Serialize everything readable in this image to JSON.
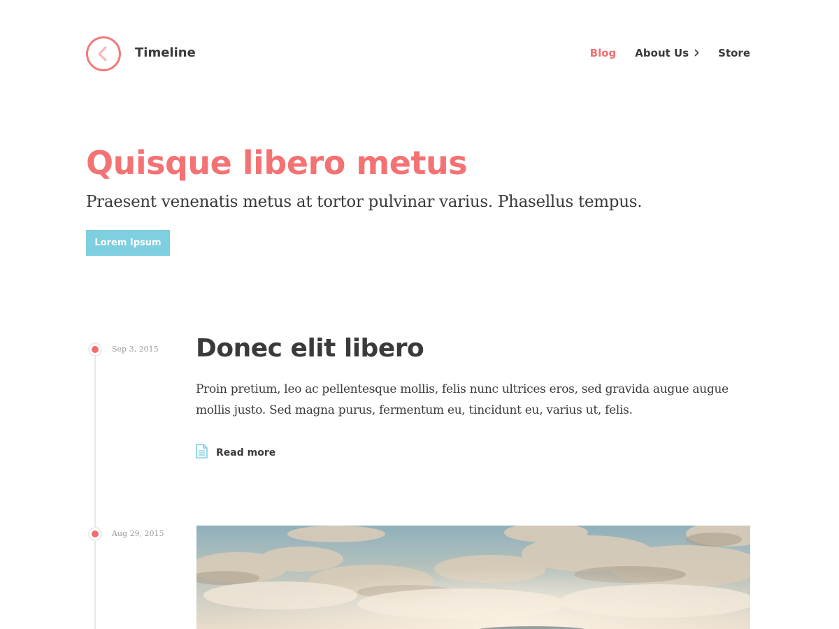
{
  "header": {
    "site_title": "Timeline",
    "logo_icon": "chevron-left-circle-icon",
    "nav": [
      {
        "label": "Blog",
        "active": true
      },
      {
        "label": "About Us",
        "has_submenu": true
      },
      {
        "label": "Store"
      }
    ]
  },
  "hero": {
    "title": "Quisque libero metus",
    "subtitle": "Praesent venenatis metus at tortor pulvinar varius. Phasellus tempus.",
    "button_label": "Lorem Ipsum"
  },
  "posts": [
    {
      "date": "Sep 3, 2015",
      "title": "Donec elit libero",
      "excerpt": "Proin pretium, leo ac pellentesque mollis, felis nunc ultrices eros, sed gravida augue augue mollis justo. Sed magna purus, fermentum eu, tincidunt eu, varius ut, felis.",
      "read_more_label": "Read more",
      "read_more_icon": "document-icon"
    },
    {
      "date": "Aug 29, 2015",
      "featured_image": "cloudy-sky-photo"
    }
  ],
  "colors": {
    "accent": "#f47273",
    "button": "#7ecfe0",
    "text": "#3a3a3a",
    "date_text": "#9a9a9a",
    "timeline_line": "#e8e8e8"
  }
}
